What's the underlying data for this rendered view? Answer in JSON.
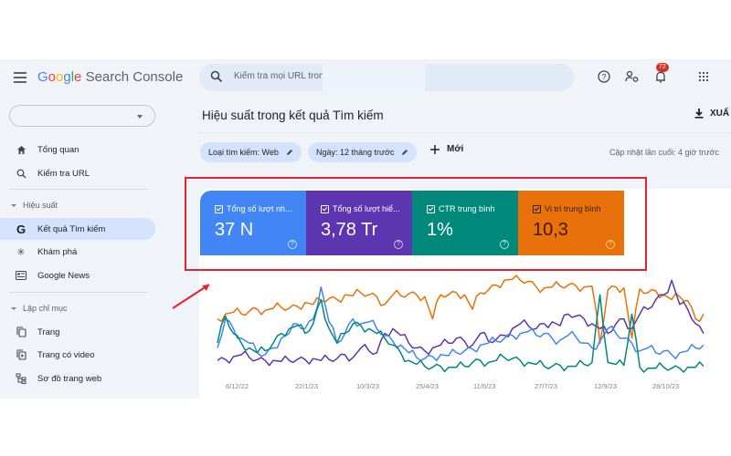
{
  "app": {
    "name_prefix": "Google",
    "name_suffix": "Search Console",
    "logo_letters": [
      "G",
      "o",
      "o",
      "g",
      "l",
      "e"
    ]
  },
  "search": {
    "placeholder": "Kiểm tra mọi URL trong"
  },
  "topbar": {
    "icons": [
      "help-icon",
      "manage-users-icon",
      "notifications-icon",
      "apps-icon"
    ],
    "notification_count": "72"
  },
  "sidebar": {
    "property_value": "",
    "items_top": [
      {
        "label": "Tổng quan",
        "icon": "home-icon"
      },
      {
        "label": "Kiểm tra URL",
        "icon": "search-icon"
      }
    ],
    "sections": [
      {
        "title": "Hiệu suất",
        "items": [
          {
            "label": "Kết quả Tìm kiếm",
            "icon": "google-g-icon",
            "active": true
          },
          {
            "label": "Khám phá",
            "icon": "discover-icon"
          },
          {
            "label": "Google News",
            "icon": "news-icon"
          }
        ]
      },
      {
        "title": "Lập chỉ mục",
        "items": [
          {
            "label": "Trang",
            "icon": "pages-icon"
          },
          {
            "label": "Trang có video",
            "icon": "video-pages-icon"
          },
          {
            "label": "Sơ đồ trang web",
            "icon": "sitemap-icon"
          }
        ]
      }
    ]
  },
  "main": {
    "title": "Hiệu suất trong kết quả Tìm kiếm",
    "export_label": "XUẤ",
    "filters": [
      {
        "label": "Loại tìm kiếm: Web"
      },
      {
        "label": "Ngày: 12 tháng trước"
      }
    ],
    "new_label": "Mới",
    "last_updated": "Cập nhật lần cuối: 4 giờ trước"
  },
  "metrics": [
    {
      "label": "Tổng số lượt nh...",
      "value": "37 N",
      "color": "#4285f4",
      "checked": true
    },
    {
      "label": "Tổng số lượt hiể...",
      "value": "3,78 Tr",
      "color": "#5e35b1",
      "checked": true
    },
    {
      "label": "CTR trung bình",
      "value": "1%",
      "color": "#00897b",
      "checked": true
    },
    {
      "label": "Vị trí trung bình",
      "value": "10,3",
      "color": "#e8710a",
      "checked": true
    }
  ],
  "chart_data": {
    "type": "line",
    "title": "",
    "xlabel": "",
    "ylabel": "",
    "x_ticks": [
      "6/12/22",
      "22/1/23",
      "10/3/23",
      "25/4/23",
      "11/6/23",
      "27/7/23",
      "12/9/23",
      "28/10/23"
    ],
    "y_axis_visible": false,
    "grid": false,
    "note": "Normalized relative levels (0-1, top=1) per series; absolute values not shown on axes",
    "series": [
      {
        "name": "Vị trí trung bình",
        "color": "#e8710a",
        "values": [
          0.55,
          0.6,
          0.62,
          0.6,
          0.63,
          0.65,
          0.64,
          0.66,
          0.67,
          0.66,
          0.68,
          0.72,
          0.7,
          0.74,
          0.76,
          0.75,
          0.8,
          0.79,
          0.82,
          0.8,
          0.78,
          0.7,
          0.8,
          0.79,
          0.81,
          0.8,
          0.78,
          0.55,
          0.8,
          0.8,
          0.82,
          0.8,
          0.65,
          0.82,
          0.85,
          0.9,
          0.95,
          0.96,
          0.95,
          0.94,
          0.88,
          0.87,
          0.88,
          0.89,
          0.9,
          0.89,
          0.88,
          0.89,
          0.3,
          0.85,
          0.88,
          0.87,
          0.35,
          0.86,
          0.82,
          0.84,
          0.8,
          0.75,
          0.78,
          0.74,
          0.55,
          0.6
        ]
      },
      {
        "name": "Tổng số lượt hiển thị",
        "color": "#5e35b1",
        "values": [
          0.12,
          0.13,
          0.16,
          0.18,
          0.15,
          0.13,
          0.12,
          0.12,
          0.11,
          0.12,
          0.13,
          0.13,
          0.14,
          0.12,
          0.13,
          0.14,
          0.18,
          0.15,
          0.25,
          0.22,
          0.2,
          0.4,
          0.45,
          0.38,
          0.3,
          0.25,
          0.22,
          0.25,
          0.28,
          0.3,
          0.35,
          0.32,
          0.28,
          0.4,
          0.32,
          0.34,
          0.38,
          0.45,
          0.5,
          0.48,
          0.45,
          0.5,
          0.52,
          0.48,
          0.6,
          0.58,
          0.55,
          0.5,
          0.45,
          0.4,
          0.5,
          0.55,
          0.45,
          0.6,
          0.65,
          0.75,
          0.8,
          0.95,
          0.7,
          0.65,
          0.5,
          0.4
        ]
      },
      {
        "name": "Tổng số lượt nhấp",
        "color": "#4285f4",
        "values": [
          0.25,
          0.55,
          0.45,
          0.35,
          0.3,
          0.2,
          0.18,
          0.25,
          0.35,
          0.4,
          0.5,
          0.45,
          0.55,
          0.88,
          0.52,
          0.3,
          0.4,
          0.55,
          0.5,
          0.52,
          0.45,
          0.38,
          0.32,
          0.28,
          0.2,
          0.15,
          0.14,
          0.16,
          0.18,
          0.17,
          0.2,
          0.22,
          0.24,
          0.28,
          0.3,
          0.32,
          0.35,
          0.38,
          0.4,
          0.42,
          0.38,
          0.4,
          0.35,
          0.33,
          0.38,
          0.36,
          0.3,
          0.25,
          0.32,
          0.45,
          0.4,
          0.35,
          0.3,
          0.22,
          0.25,
          0.2,
          0.22,
          0.18,
          0.2,
          0.22,
          0.25,
          0.28
        ]
      },
      {
        "name": "CTR trung bình",
        "color": "#00897b",
        "values": [
          0.3,
          0.58,
          0.4,
          0.3,
          0.25,
          0.2,
          0.22,
          0.3,
          0.4,
          0.45,
          0.48,
          0.4,
          0.5,
          0.75,
          0.45,
          0.3,
          0.4,
          0.5,
          0.48,
          0.45,
          0.4,
          0.35,
          0.28,
          0.2,
          0.12,
          0.08,
          0.06,
          0.05,
          0.06,
          0.05,
          0.05,
          0.06,
          0.1,
          0.12,
          0.1,
          0.12,
          0.15,
          0.14,
          0.12,
          0.1,
          0.08,
          0.06,
          0.06,
          0.07,
          0.06,
          0.06,
          0.08,
          0.1,
          0.8,
          0.1,
          0.08,
          0.07,
          0.6,
          0.05,
          0.04,
          0.04,
          0.05,
          0.04,
          0.04,
          0.05,
          0.05,
          0.06
        ]
      }
    ]
  }
}
